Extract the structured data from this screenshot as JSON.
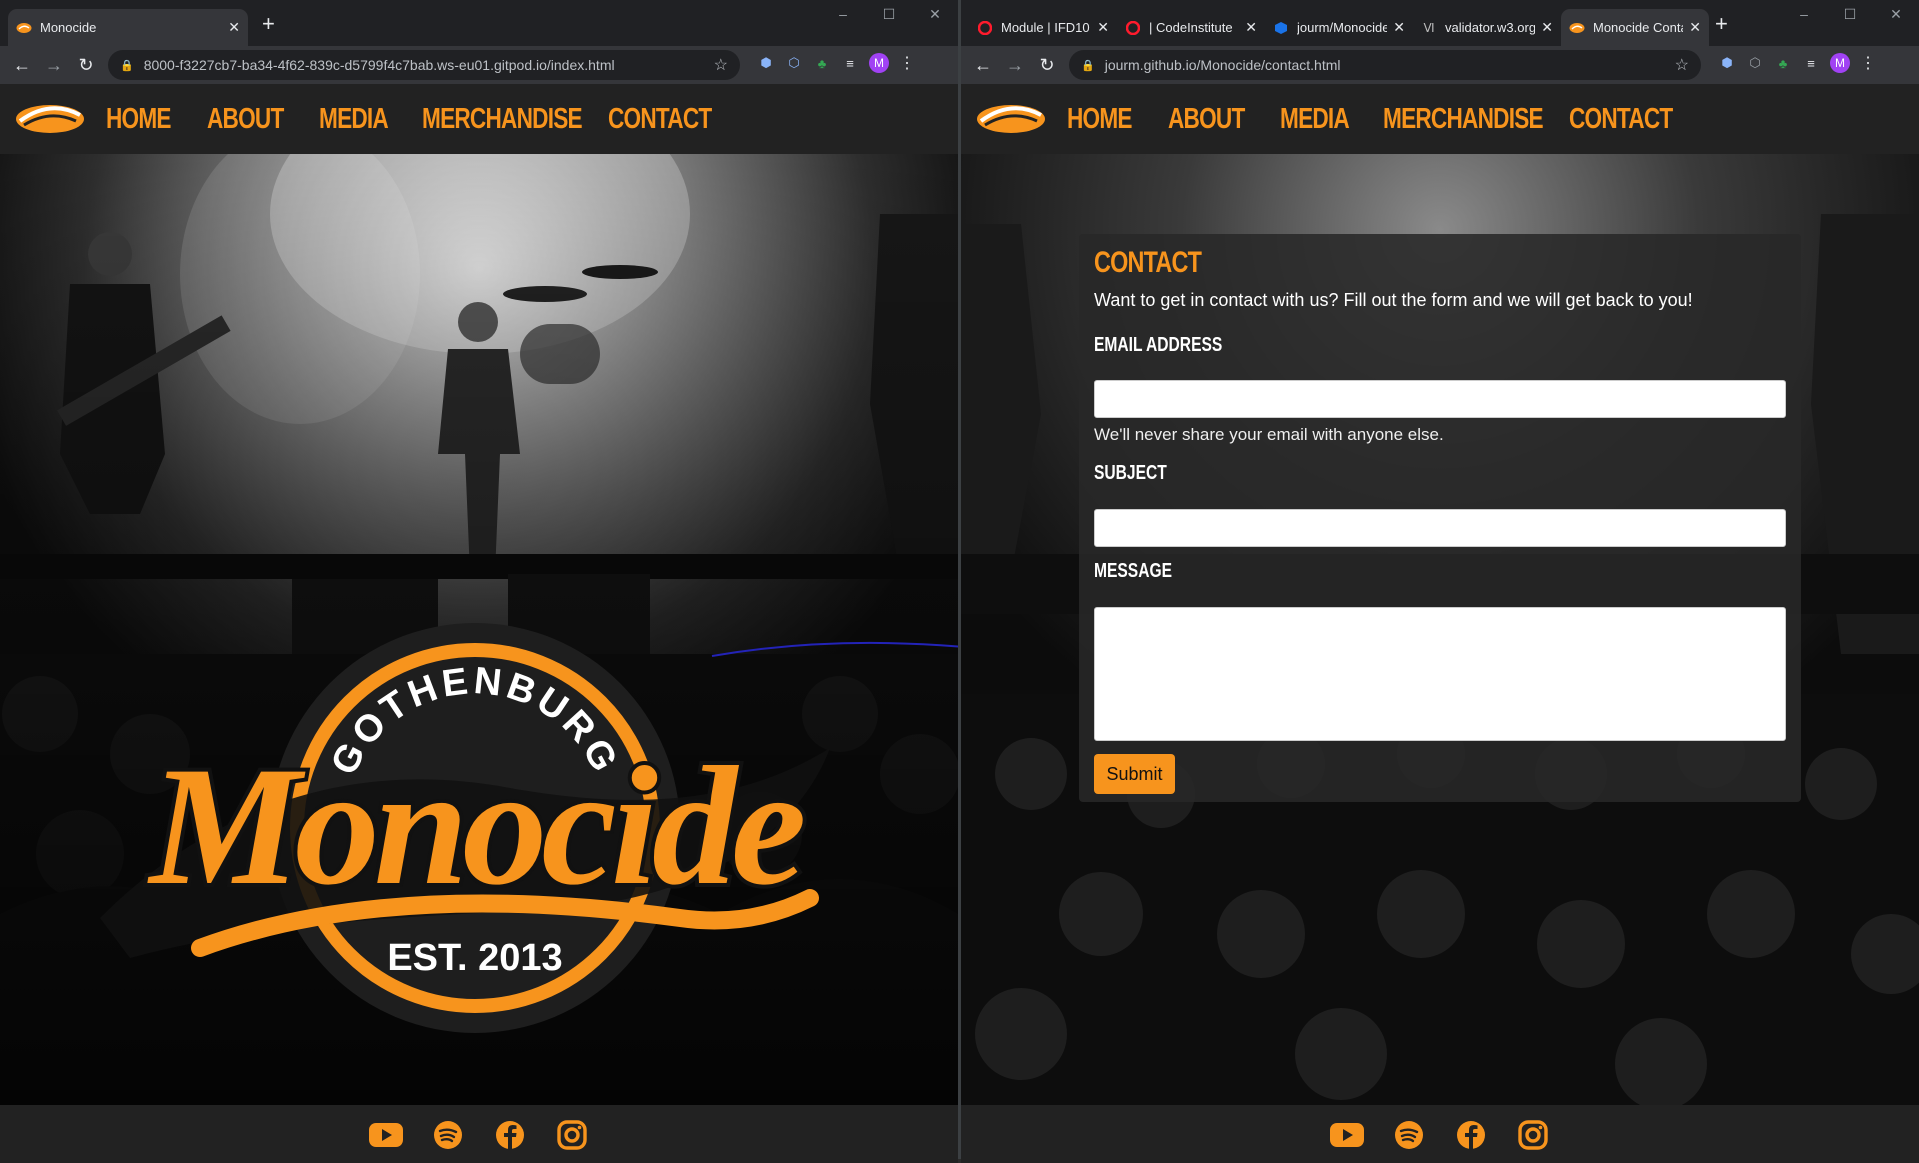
{
  "left": {
    "tabs": [
      {
        "title": "Monocide",
        "active": true
      }
    ],
    "url": "8000-f3227cb7-ba34-4f62-839c-d5799f4c7bab.ws-eu01.gitpod.io/index.html",
    "hero_logo": {
      "top_text": "GOTHENBURG",
      "main_text": "Monocide",
      "bottom_text": "EST. 2013"
    }
  },
  "right": {
    "tabs": [
      {
        "title": "Module | IFD10",
        "icon": "opera-icon"
      },
      {
        "title": "| CodeInstitute",
        "icon": "opera-icon"
      },
      {
        "title": "jourm/Monocide",
        "icon": "cube-icon"
      },
      {
        "title": "validator.w3.org",
        "icon": "validator-icon"
      },
      {
        "title": "Monocide Contact",
        "icon": "logo-icon",
        "active": true
      }
    ],
    "url": "jourm.github.io/Monocide/contact.html",
    "contact": {
      "title": "CONTACT",
      "lead": "Want to get in contact with us? Fill out the form and we will get back to you!",
      "email_label": "EMAIL ADDRESS",
      "email_help": "We'll never share your email with anyone else.",
      "subject_label": "SUBJECT",
      "message_label": "MESSAGE",
      "submit_label": "Submit"
    }
  },
  "nav": {
    "items": [
      "HOME",
      "ABOUT",
      "MEDIA",
      "MERCHANDISE",
      "CONTACT"
    ]
  },
  "avatar_letter": "M",
  "brand_color": "#f7941d",
  "nav_bg": "#222222",
  "footer_icons": [
    "youtube-icon",
    "spotify-icon",
    "facebook-icon",
    "instagram-icon"
  ]
}
